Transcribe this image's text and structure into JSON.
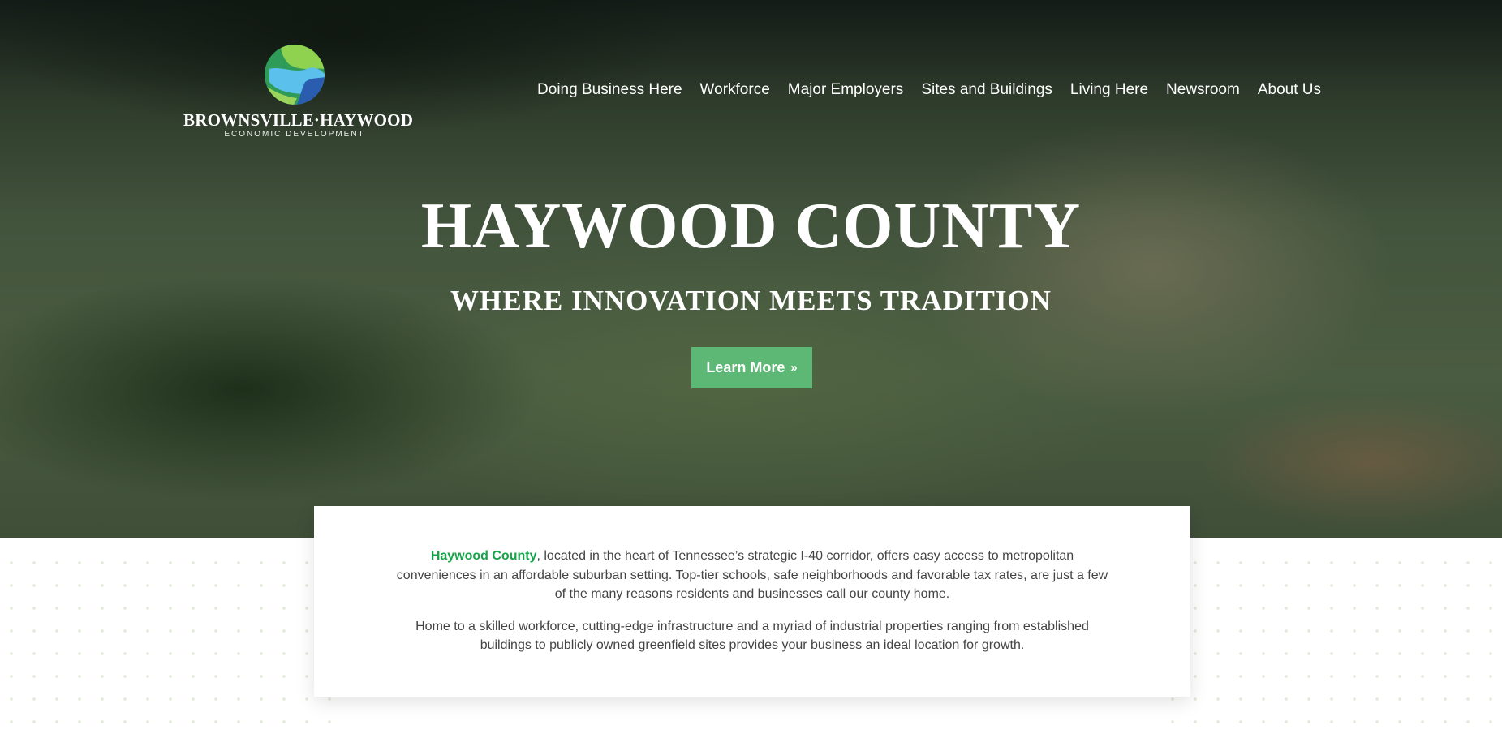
{
  "brand": {
    "name": "BROWNSVILLE·HAYWOOD",
    "subtitle": "ECONOMIC DEVELOPMENT",
    "colors": [
      "#2e8b57",
      "#7ec850",
      "#5bc0eb",
      "#2a5db0"
    ]
  },
  "nav": {
    "items": [
      {
        "label": "Doing Business Here"
      },
      {
        "label": "Workforce"
      },
      {
        "label": "Major Employers"
      },
      {
        "label": "Sites and Buildings"
      },
      {
        "label": "Living Here"
      },
      {
        "label": "Newsroom"
      },
      {
        "label": "About Us"
      }
    ]
  },
  "hero": {
    "title": "HAYWOOD COUNTY",
    "tagline": "WHERE INNOVATION MEETS TRADITION",
    "cta_label": "Learn More",
    "cta_icon": "double-chevron-right-icon",
    "cta_glyph": "»"
  },
  "intro": {
    "highlight": "Haywood County",
    "para1_rest": ", located in the heart of Tennessee’s strategic I-40 corridor, offers easy access to metropolitan conveniences in an affordable suburban setting. Top-tier schools, safe neighborhoods and favorable tax rates, are just a few of the many reasons residents and businesses call our county home.",
    "para2": "Home to a skilled workforce, cutting-edge infrastructure and a myriad of industrial properties ranging from established buildings to publicly owned greenfield sites provides your business an ideal location for growth."
  },
  "colors": {
    "accent": "#5cb874",
    "highlight_text": "#15a349"
  }
}
